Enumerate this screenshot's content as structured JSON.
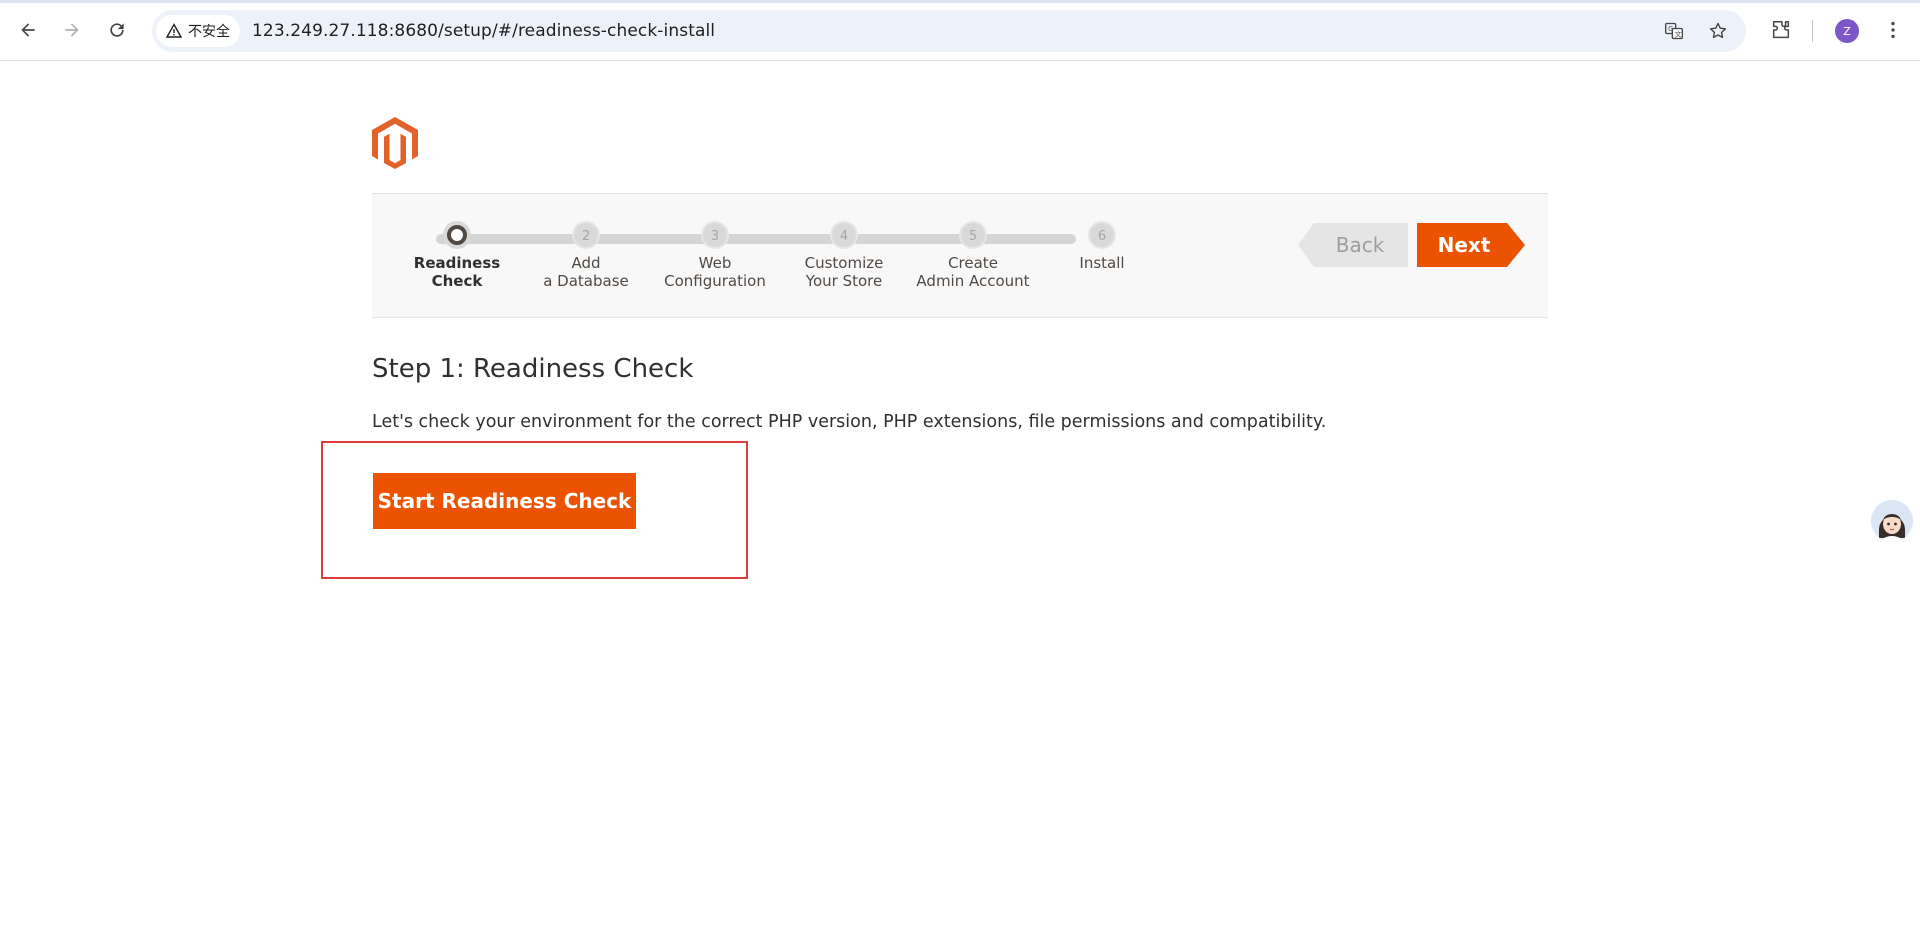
{
  "browser": {
    "security_label": "不安全",
    "url": "123.249.27.118:8680/setup/#/readiness-check-install",
    "profile_initial": "Z"
  },
  "wizard": {
    "steps": [
      {
        "number": "1",
        "label_line1": "Readiness",
        "label_line2": "Check",
        "active": true
      },
      {
        "number": "2",
        "label_line1": "Add",
        "label_line2": "a Database",
        "active": false
      },
      {
        "number": "3",
        "label_line1": "Web",
        "label_line2": "Configuration",
        "active": false
      },
      {
        "number": "4",
        "label_line1": "Customize",
        "label_line2": "Your Store",
        "active": false
      },
      {
        "number": "5",
        "label_line1": "Create",
        "label_line2": "Admin Account",
        "active": false
      },
      {
        "number": "6",
        "label_line1": "Install",
        "label_line2": "",
        "active": false
      }
    ],
    "back_label": "Back",
    "next_label": "Next"
  },
  "main": {
    "title": "Step 1: Readiness Check",
    "description": "Let's check your environment for the correct PHP version, PHP extensions, file permissions and compatibility.",
    "start_button_label": "Start Readiness Check"
  },
  "colors": {
    "accent": "#eb5202",
    "highlight": "#e03b3b",
    "wizard_bg": "#f8f8f8"
  }
}
